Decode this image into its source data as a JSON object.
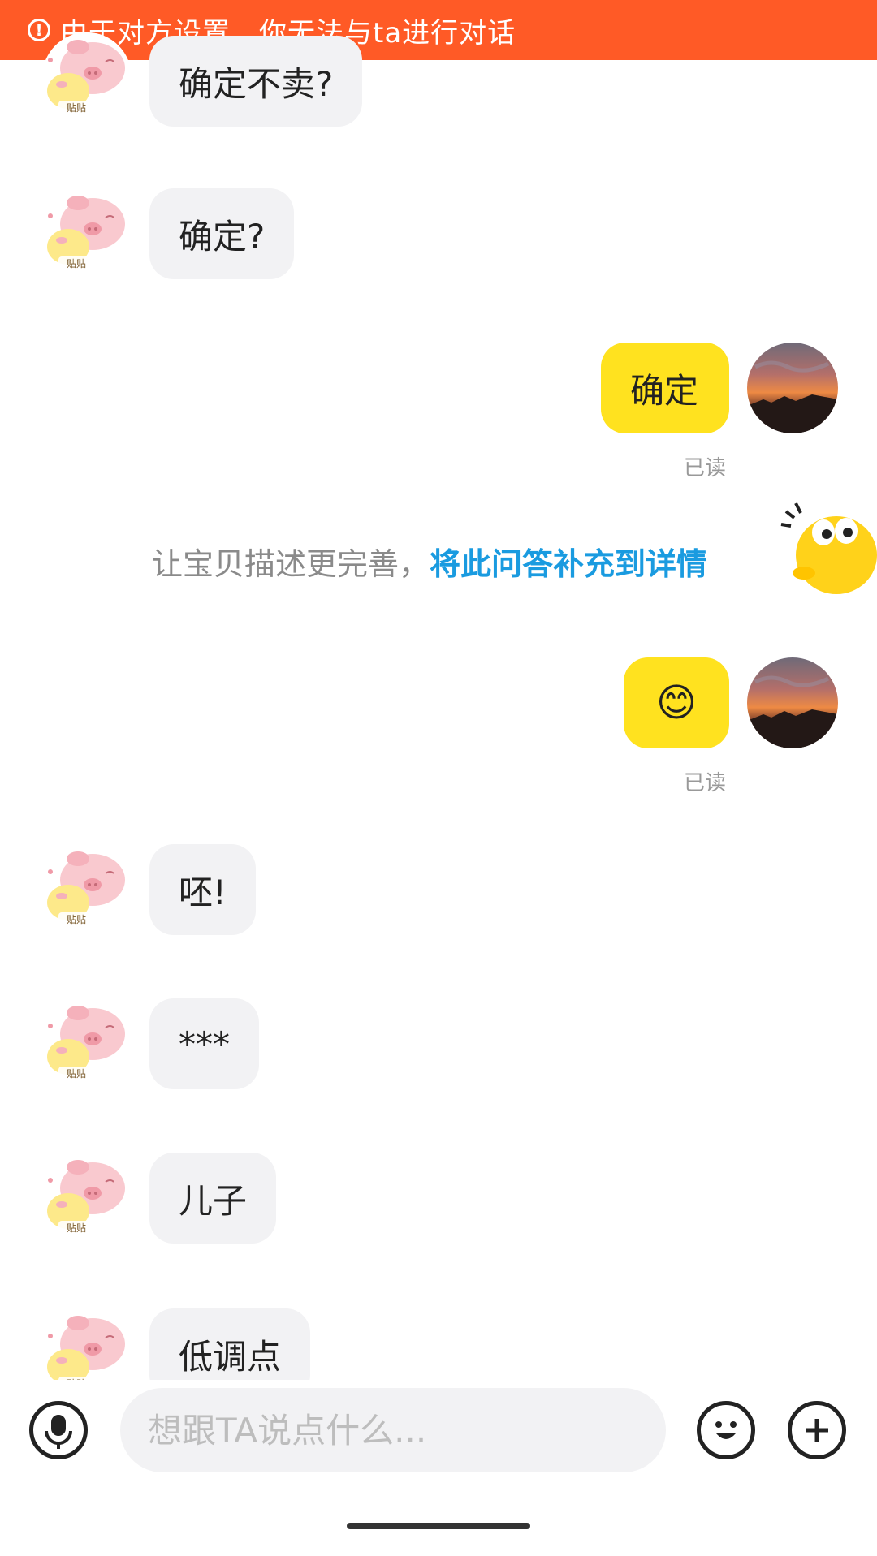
{
  "banner": {
    "text": "由于对方设置，你无法与ta进行对话",
    "icon": "info-circle-icon",
    "color": "#ff5a26"
  },
  "messages": [
    {
      "side": "left",
      "text": "确定不卖?"
    },
    {
      "side": "left",
      "text": "确定?"
    },
    {
      "side": "right",
      "text": "确定",
      "status": "已读"
    },
    {
      "side": "right",
      "emoji": "😊",
      "status": "已读"
    },
    {
      "side": "left",
      "text": "呸!"
    },
    {
      "side": "left",
      "text": "***"
    },
    {
      "side": "left",
      "text": "儿子"
    },
    {
      "side": "left",
      "text": "低调点"
    }
  ],
  "hint": {
    "text": "让宝贝描述更完善，",
    "link": "将此问答补充到详情"
  },
  "composer": {
    "placeholder": "想跟TA说点什么..."
  },
  "colors": {
    "bubble_right": "#ffe21f",
    "bubble_left": "#f2f2f4",
    "link": "#1a9be0",
    "banner": "#ff5a26"
  }
}
